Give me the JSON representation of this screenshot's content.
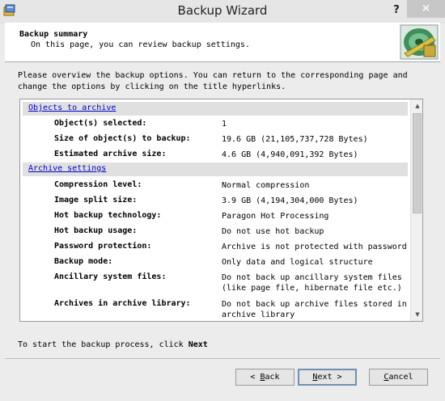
{
  "window": {
    "title": "Backup Wizard",
    "help_label": "?",
    "close_label": "✕"
  },
  "header": {
    "title": "Backup summary",
    "subtitle": "On this page, you can review backup settings."
  },
  "intro": "Please overview the backup options. You can return to the corresponding page and change the options by clicking on the title hyperlinks.",
  "sections": {
    "objects": {
      "title": "Objects to archive",
      "rows": [
        {
          "label": "Object(s) selected:",
          "value": "1"
        },
        {
          "label": "Size of object(s) to backup:",
          "value": "19.6 GB (21,105,737,728 Bytes)"
        },
        {
          "label": "Estimated archive size:",
          "value": "4.6 GB (4,940,091,392 Bytes)"
        }
      ]
    },
    "archive": {
      "title": "Archive settings",
      "rows": [
        {
          "label": "Compression level:",
          "value": "Normal compression"
        },
        {
          "label": "Image split size:",
          "value": "3.9 GB (4,194,304,000 Bytes)"
        },
        {
          "label": "Hot backup technology:",
          "value": "Paragon Hot Processing"
        },
        {
          "label": "Hot backup usage:",
          "value": "Do not use hot backup"
        },
        {
          "label": "Password protection:",
          "value": "Archive is not protected with password"
        },
        {
          "label": "Backup mode:",
          "value": "Only data and logical structure"
        },
        {
          "label": "Ancillary system files:",
          "value": "Do not back up ancillary system files",
          "value2": "(like page file, hibernate file etc.)"
        },
        {
          "label": "Archives in archive library:",
          "value": "Do not back up archive files stored in",
          "value2": "archive library"
        }
      ]
    }
  },
  "footer": {
    "text": "To start the backup process, click ",
    "bold": "Next"
  },
  "buttons": {
    "back": {
      "prefix": "< ",
      "key": "B",
      "rest": "ack"
    },
    "next": {
      "key": "N",
      "rest": "ext",
      "suffix": " >"
    },
    "cancel": {
      "key": "C",
      "rest": "ancel"
    }
  },
  "icons": {
    "app": "backup-app-icon",
    "logo": "backup-disk-logo",
    "scroll_up": "scroll-up-arrow-icon",
    "scroll_down": "scroll-down-arrow-icon"
  }
}
